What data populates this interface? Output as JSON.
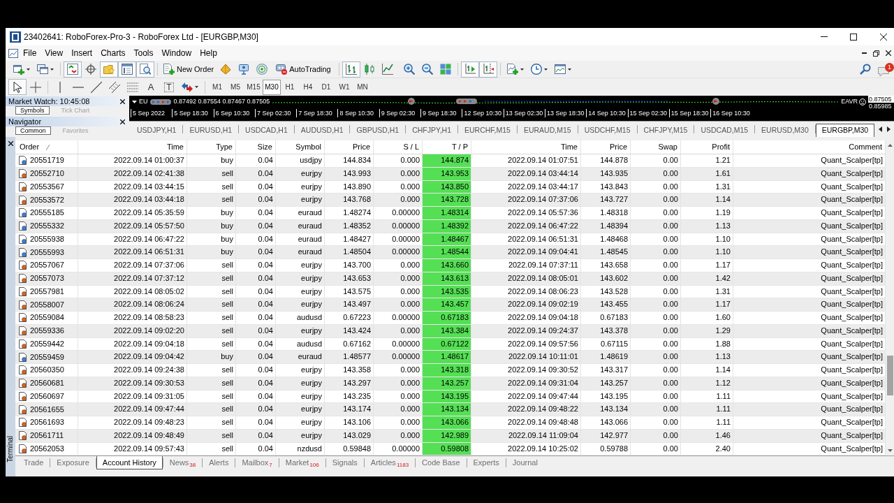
{
  "window": {
    "title": "23402641: RoboForex-Pro-3 - RoboForex Ltd - [EURGBP,M30]"
  },
  "menu": [
    "File",
    "View",
    "Insert",
    "Charts",
    "Tools",
    "Window",
    "Help"
  ],
  "toolbar": [
    {
      "pressed": false
    },
    {
      "pressed": false
    },
    {
      "pressed": true
    },
    {
      "pressed": false
    },
    {
      "pressed": true
    },
    {
      "pressed": true
    },
    {
      "pressed": true
    },
    {
      "label": "New Order",
      "pressed": false
    },
    {
      "pressed": false
    },
    {
      "pressed": false
    },
    {
      "pressed": false
    },
    {
      "label": "AutoTrading",
      "pressed": false
    },
    {
      "pressed": true
    },
    {
      "pressed": false
    },
    {
      "pressed": false
    },
    {
      "pressed": false
    },
    {
      "pressed": false
    },
    {
      "pressed": false
    },
    {
      "pressed": true
    },
    {
      "pressed": true
    },
    {
      "pressed": false
    },
    {
      "pressed": false
    },
    {
      "pressed": false
    }
  ],
  "notifications": {
    "count": "1"
  },
  "drawing_tools": [
    {
      "pressed": true
    },
    {
      "pressed": false
    },
    {
      "pressed": false
    },
    {
      "pressed": false
    },
    {
      "pressed": false
    },
    {
      "pressed": false
    },
    {
      "pressed": false
    },
    {
      "glyph": "A",
      "pressed": false
    },
    {
      "glyph": "T",
      "pressed": false
    },
    {
      "pressed": false
    }
  ],
  "timeframes": [
    {
      "label": "M1",
      "selected": false
    },
    {
      "label": "M5",
      "selected": false
    },
    {
      "label": "M15",
      "selected": false
    },
    {
      "label": "M30",
      "selected": true
    },
    {
      "label": "H1",
      "selected": false
    },
    {
      "label": "H4",
      "selected": false
    },
    {
      "label": "D1",
      "selected": false
    },
    {
      "label": "W1",
      "selected": false
    },
    {
      "label": "MN",
      "selected": false
    }
  ],
  "market_watch": {
    "title": "Market Watch: 10:45:08",
    "tabs": [
      {
        "label": "Symbols",
        "selected": true
      },
      {
        "label": "Tick Chart",
        "selected": false
      }
    ]
  },
  "navigator": {
    "title": "Navigator",
    "tabs": [
      {
        "label": "Common",
        "selected": true
      },
      {
        "label": "Favorites",
        "selected": false
      }
    ]
  },
  "chart": {
    "symbol": "EU",
    "ohlc": "0.87492 0.87554 0.87467 0.87505",
    "expert": "EAVR",
    "price_labels": [
      "0.87505",
      "0.85985"
    ],
    "time_labels": [
      "5 Sep 2022",
      "5 Sep 18:30",
      "6 Sep 10:30",
      "7 Sep 02:30",
      "7 Sep 18:30",
      "8 Sep 10:30",
      "9 Sep 02:30",
      "9 Sep 18:30",
      "12 Sep 10:30",
      "13 Sep 02:30",
      "13 Sep 18:30",
      "14 Sep 10:30",
      "15 Sep 02:30",
      "15 Sep 18:30",
      "16 Sep 10:30"
    ]
  },
  "chart_tabs": [
    {
      "label": "USDJPY,H1",
      "selected": false
    },
    {
      "label": "EURUSD,H1",
      "selected": false
    },
    {
      "label": "USDCAD,H1",
      "selected": false
    },
    {
      "label": "AUDUSD,H1",
      "selected": false
    },
    {
      "label": "GBPUSD,H1",
      "selected": false
    },
    {
      "label": "CHFJPY,H1",
      "selected": false
    },
    {
      "label": "EURCHF,M15",
      "selected": false
    },
    {
      "label": "EURAUD,M15",
      "selected": false
    },
    {
      "label": "USDCHF,M15",
      "selected": false
    },
    {
      "label": "CHFJPY,M15",
      "selected": false
    },
    {
      "label": "USDCAD,M15",
      "selected": false
    },
    {
      "label": "EURUSD,M30",
      "selected": false
    },
    {
      "label": "EURGBP,M30",
      "selected": true
    }
  ],
  "terminal": {
    "title": "Terminal",
    "table": {
      "columns": [
        {
          "label": "Order",
          "sorted": true
        },
        {
          "label": "Time",
          "sorted": false
        },
        {
          "label": "Type",
          "sorted": false
        },
        {
          "label": "Size",
          "sorted": false
        },
        {
          "label": "Symbol",
          "sorted": false
        },
        {
          "label": "Price",
          "sorted": false
        },
        {
          "label": "S / L",
          "sorted": false
        },
        {
          "label": "T / P",
          "sorted": false
        },
        {
          "label": "Time",
          "sorted": false
        },
        {
          "label": "Price",
          "sorted": false
        },
        {
          "label": "Swap",
          "sorted": false
        },
        {
          "label": "Profit",
          "sorted": false
        },
        {
          "label": "Comment",
          "sorted": false
        }
      ],
      "rows": [
        {
          "kind": "buy",
          "tp_hit": true,
          "cells": [
            "20551719",
            "2022.09.14 01:00:37",
            "buy",
            "0.04",
            "usdjpy",
            "144.834",
            "0.000",
            "144.874",
            "2022.09.14 01:07:51",
            "144.878",
            "0.00",
            "1.21",
            "Quant_Scalper[tp]"
          ]
        },
        {
          "kind": "sell",
          "tp_hit": true,
          "cells": [
            "20552710",
            "2022.09.14 02:41:38",
            "sell",
            "0.04",
            "eurjpy",
            "143.993",
            "0.000",
            "143.953",
            "2022.09.14 03:44:14",
            "143.935",
            "0.00",
            "1.61",
            "Quant_Scalper[tp]"
          ]
        },
        {
          "kind": "sell",
          "tp_hit": true,
          "cells": [
            "20553567",
            "2022.09.14 03:44:15",
            "sell",
            "0.04",
            "eurjpy",
            "143.890",
            "0.000",
            "143.850",
            "2022.09.14 03:44:17",
            "143.843",
            "0.00",
            "1.31",
            "Quant_Scalper[tp]"
          ]
        },
        {
          "kind": "sell",
          "tp_hit": true,
          "cells": [
            "20553572",
            "2022.09.14 03:44:18",
            "sell",
            "0.04",
            "eurjpy",
            "143.768",
            "0.000",
            "143.728",
            "2022.09.14 07:37:06",
            "143.727",
            "0.00",
            "1.14",
            "Quant_Scalper[tp]"
          ]
        },
        {
          "kind": "buy",
          "tp_hit": true,
          "cells": [
            "20555185",
            "2022.09.14 05:35:59",
            "buy",
            "0.04",
            "euraud",
            "1.48274",
            "0.00000",
            "1.48314",
            "2022.09.14 05:57:36",
            "1.48318",
            "0.00",
            "1.19",
            "Quant_Scalper[tp]"
          ]
        },
        {
          "kind": "buy",
          "tp_hit": true,
          "cells": [
            "20555332",
            "2022.09.14 05:57:50",
            "buy",
            "0.04",
            "euraud",
            "1.48352",
            "0.00000",
            "1.48392",
            "2022.09.14 06:47:22",
            "1.48394",
            "0.00",
            "1.13",
            "Quant_Scalper[tp]"
          ]
        },
        {
          "kind": "buy",
          "tp_hit": true,
          "cells": [
            "20555938",
            "2022.09.14 06:47:22",
            "buy",
            "0.04",
            "euraud",
            "1.48427",
            "0.00000",
            "1.48467",
            "2022.09.14 06:51:31",
            "1.48468",
            "0.00",
            "1.10",
            "Quant_Scalper[tp]"
          ]
        },
        {
          "kind": "buy",
          "tp_hit": true,
          "cells": [
            "20555993",
            "2022.09.14 06:51:31",
            "buy",
            "0.04",
            "euraud",
            "1.48504",
            "0.00000",
            "1.48544",
            "2022.09.14 09:04:41",
            "1.48545",
            "0.00",
            "1.10",
            "Quant_Scalper[tp]"
          ]
        },
        {
          "kind": "sell",
          "tp_hit": true,
          "cells": [
            "20557067",
            "2022.09.14 07:37:06",
            "sell",
            "0.04",
            "eurjpy",
            "143.700",
            "0.000",
            "143.660",
            "2022.09.14 07:37:11",
            "143.658",
            "0.00",
            "1.17",
            "Quant_Scalper[tp]"
          ]
        },
        {
          "kind": "sell",
          "tp_hit": true,
          "cells": [
            "20557073",
            "2022.09.14 07:37:12",
            "sell",
            "0.04",
            "eurjpy",
            "143.653",
            "0.000",
            "143.613",
            "2022.09.14 08:05:01",
            "143.602",
            "0.00",
            "1.42",
            "Quant_Scalper[tp]"
          ]
        },
        {
          "kind": "sell",
          "tp_hit": true,
          "cells": [
            "20557981",
            "2022.09.14 08:05:02",
            "sell",
            "0.04",
            "eurjpy",
            "143.575",
            "0.000",
            "143.535",
            "2022.09.14 08:06:23",
            "143.528",
            "0.00",
            "1.31",
            "Quant_Scalper[tp]"
          ]
        },
        {
          "kind": "sell",
          "tp_hit": true,
          "cells": [
            "20558007",
            "2022.09.14 08:06:24",
            "sell",
            "0.04",
            "eurjpy",
            "143.497",
            "0.000",
            "143.457",
            "2022.09.14 09:02:19",
            "143.455",
            "0.00",
            "1.17",
            "Quant_Scalper[tp]"
          ]
        },
        {
          "kind": "sell",
          "tp_hit": true,
          "cells": [
            "20559084",
            "2022.09.14 08:58:23",
            "sell",
            "0.04",
            "audusd",
            "0.67223",
            "0.00000",
            "0.67183",
            "2022.09.14 09:04:18",
            "0.67183",
            "0.00",
            "1.60",
            "Quant_Scalper[tp]"
          ]
        },
        {
          "kind": "sell",
          "tp_hit": true,
          "cells": [
            "20559336",
            "2022.09.14 09:02:20",
            "sell",
            "0.04",
            "eurjpy",
            "143.424",
            "0.000",
            "143.384",
            "2022.09.14 09:24:37",
            "143.378",
            "0.00",
            "1.29",
            "Quant_Scalper[tp]"
          ]
        },
        {
          "kind": "sell",
          "tp_hit": true,
          "cells": [
            "20559442",
            "2022.09.14 09:04:18",
            "sell",
            "0.04",
            "audusd",
            "0.67162",
            "0.00000",
            "0.67122",
            "2022.09.14 09:57:56",
            "0.67115",
            "0.00",
            "1.88",
            "Quant_Scalper[tp]"
          ]
        },
        {
          "kind": "buy",
          "tp_hit": true,
          "cells": [
            "20559459",
            "2022.09.14 09:04:42",
            "buy",
            "0.04",
            "euraud",
            "1.48577",
            "0.00000",
            "1.48617",
            "2022.09.14 10:11:01",
            "1.48619",
            "0.00",
            "1.13",
            "Quant_Scalper[tp]"
          ]
        },
        {
          "kind": "sell",
          "tp_hit": true,
          "cells": [
            "20560350",
            "2022.09.14 09:24:38",
            "sell",
            "0.04",
            "eurjpy",
            "143.358",
            "0.000",
            "143.318",
            "2022.09.14 09:30:52",
            "143.317",
            "0.00",
            "1.14",
            "Quant_Scalper[tp]"
          ]
        },
        {
          "kind": "sell",
          "tp_hit": true,
          "cells": [
            "20560681",
            "2022.09.14 09:30:53",
            "sell",
            "0.04",
            "eurjpy",
            "143.297",
            "0.000",
            "143.257",
            "2022.09.14 09:31:04",
            "143.257",
            "0.00",
            "1.12",
            "Quant_Scalper[tp]"
          ]
        },
        {
          "kind": "sell",
          "tp_hit": true,
          "cells": [
            "20560697",
            "2022.09.14 09:31:05",
            "sell",
            "0.04",
            "eurjpy",
            "143.235",
            "0.000",
            "143.195",
            "2022.09.14 09:47:44",
            "143.195",
            "0.00",
            "1.11",
            "Quant_Scalper[tp]"
          ]
        },
        {
          "kind": "sell",
          "tp_hit": true,
          "cells": [
            "20561655",
            "2022.09.14 09:47:44",
            "sell",
            "0.04",
            "eurjpy",
            "143.174",
            "0.000",
            "143.134",
            "2022.09.14 09:48:22",
            "143.134",
            "0.00",
            "1.11",
            "Quant_Scalper[tp]"
          ]
        },
        {
          "kind": "sell",
          "tp_hit": true,
          "cells": [
            "20561693",
            "2022.09.14 09:48:23",
            "sell",
            "0.04",
            "eurjpy",
            "143.106",
            "0.000",
            "143.066",
            "2022.09.14 09:48:48",
            "143.066",
            "0.00",
            "1.11",
            "Quant_Scalper[tp]"
          ]
        },
        {
          "kind": "sell",
          "tp_hit": true,
          "cells": [
            "20561711",
            "2022.09.14 09:48:49",
            "sell",
            "0.04",
            "eurjpy",
            "143.029",
            "0.000",
            "142.989",
            "2022.09.14 11:09:04",
            "142.977",
            "0.00",
            "1.46",
            "Quant_Scalper[tp]"
          ]
        },
        {
          "kind": "sell",
          "tp_hit": true,
          "cells": [
            "20562053",
            "2022.09.14 09:57:43",
            "sell",
            "0.04",
            "nzdusd",
            "0.59848",
            "0.00000",
            "0.59808",
            "2022.09.14 10:25:02",
            "0.59788",
            "0.00",
            "2.40",
            "Quant_Scalper[tp]"
          ]
        }
      ]
    },
    "tabs": [
      {
        "label": "Trade",
        "selected": false
      },
      {
        "label": "Exposure",
        "selected": false
      },
      {
        "label": "Account History",
        "selected": true
      },
      {
        "label": "News",
        "count": "38",
        "selected": false
      },
      {
        "label": "Alerts",
        "selected": false
      },
      {
        "label": "Mailbox",
        "count": "7",
        "selected": false
      },
      {
        "label": "Market",
        "count": "106",
        "selected": false
      },
      {
        "label": "Signals",
        "selected": false
      },
      {
        "label": "Articles",
        "count": "1183",
        "selected": false
      },
      {
        "label": "Code Base",
        "selected": false
      },
      {
        "label": "Experts",
        "selected": false
      },
      {
        "label": "Journal",
        "selected": false
      }
    ]
  }
}
